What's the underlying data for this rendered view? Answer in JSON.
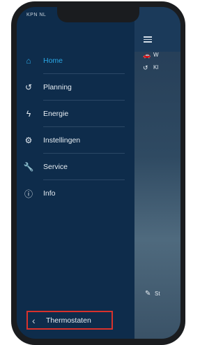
{
  "status": {
    "carrier": "KPN NL"
  },
  "menu": {
    "items": [
      {
        "label": "Home",
        "icon": "home-icon",
        "active": true
      },
      {
        "label": "Planning",
        "icon": "clock-back-icon",
        "active": false
      },
      {
        "label": "Energie",
        "icon": "bolt-icon",
        "active": false
      },
      {
        "label": "Instellingen",
        "icon": "gear-icon",
        "active": false
      },
      {
        "label": "Service",
        "icon": "wrench-icon",
        "active": false
      },
      {
        "label": "Info",
        "icon": "info-icon",
        "active": false
      }
    ]
  },
  "bottom": {
    "label": "Thermostaten",
    "icon": "chevron-left-icon"
  },
  "overlay": {
    "text1": "W",
    "text2": "Kl",
    "text3": "St"
  },
  "colors": {
    "drawer_bg": "#0e2c4b",
    "accent": "#2aa8e6",
    "highlight_border": "#d8322c"
  }
}
